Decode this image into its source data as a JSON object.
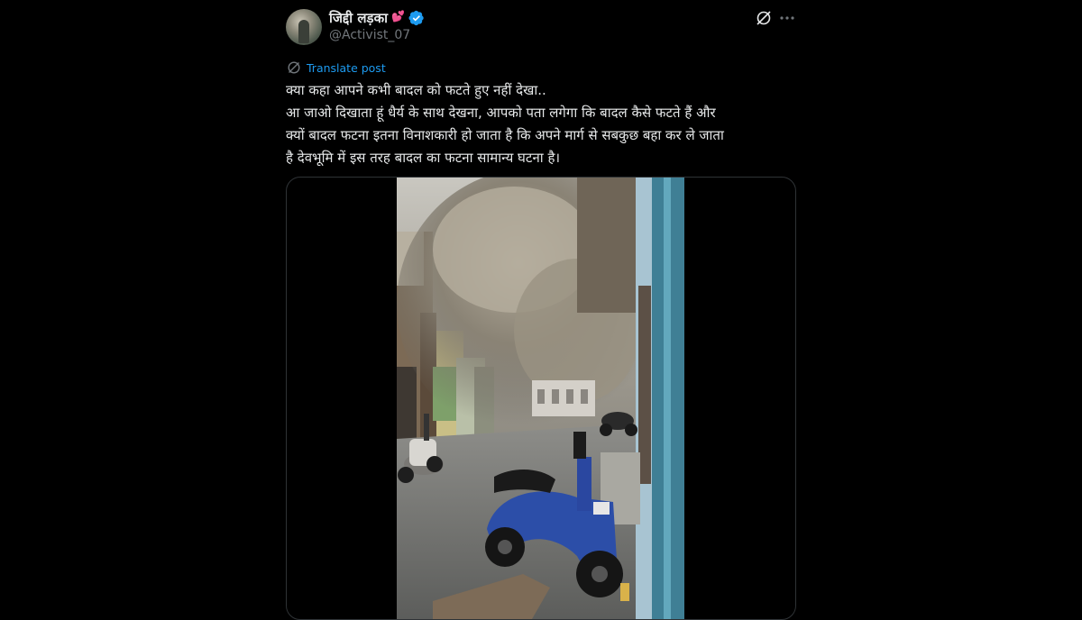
{
  "author": {
    "display_name": "जिद्दी लड़का",
    "name_emoji_icon": "heart-icon",
    "verified_icon": "verified-badge-icon",
    "handle": "@Activist_07",
    "avatar_icon": "avatar"
  },
  "header_actions": {
    "grok_icon": "grok-icon",
    "more_icon": "more-options-icon"
  },
  "translate": {
    "label": "Translate post",
    "icon": "globe-icon"
  },
  "post_text": {
    "lines": [
      "क्या कहा आपने कभी बादल को फटते हुए नहीं देखा..",
      "आ जाओ दिखाता हूं धैर्य के साथ देखना, आपको पता लगेगा कि बादल कैसे फटते हैं और",
      "क्यों बादल फटना इतना विनाशकारी हो जाता है कि अपने मार्ग से सबकुछ बहा कर ले जाता",
      "है देवभूमि में इस तरह बादल का फटना सामान्य घटना है।"
    ]
  },
  "media": {
    "type": "video",
    "scene": "cloudburst-street-video"
  },
  "colors": {
    "background": "#000000",
    "text_primary": "#e7e9ea",
    "text_secondary": "#71767b",
    "accent": "#1d9bf0",
    "border": "#2f3336"
  }
}
